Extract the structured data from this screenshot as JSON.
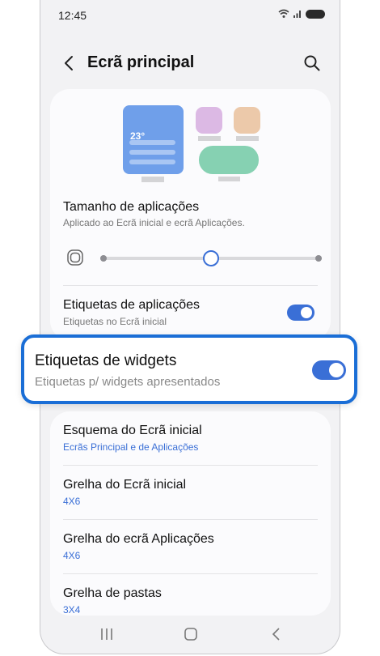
{
  "status": {
    "time": "12:45"
  },
  "header": {
    "title": "Ecrã principal"
  },
  "preview": {
    "widget_temp": "23°"
  },
  "app_size": {
    "title": "Tamanho de aplicações",
    "subtitle": "Aplicado ao Ecrã inicial e ecrã Aplicações.",
    "slider_level": 0.5
  },
  "app_labels": {
    "title": "Etiquetas de aplicações",
    "subtitle": "Etiquetas no Ecrã inicial",
    "enabled": true
  },
  "widget_labels": {
    "title": "Etiquetas de widgets",
    "subtitle": "Etiquetas p/ widgets apresentados",
    "enabled": true
  },
  "settings": [
    {
      "title": "Esquema do Ecrã inicial",
      "value": "Ecrãs Principal e de Aplicações"
    },
    {
      "title": "Grelha do Ecrã inicial",
      "value": "4X6"
    },
    {
      "title": "Grelha do ecrã Aplicações",
      "value": "4X6"
    },
    {
      "title": "Grelha de pastas",
      "value": "3X4"
    }
  ],
  "colors": {
    "accent": "#3a6fd6",
    "highlight": "#1a6ed6"
  }
}
